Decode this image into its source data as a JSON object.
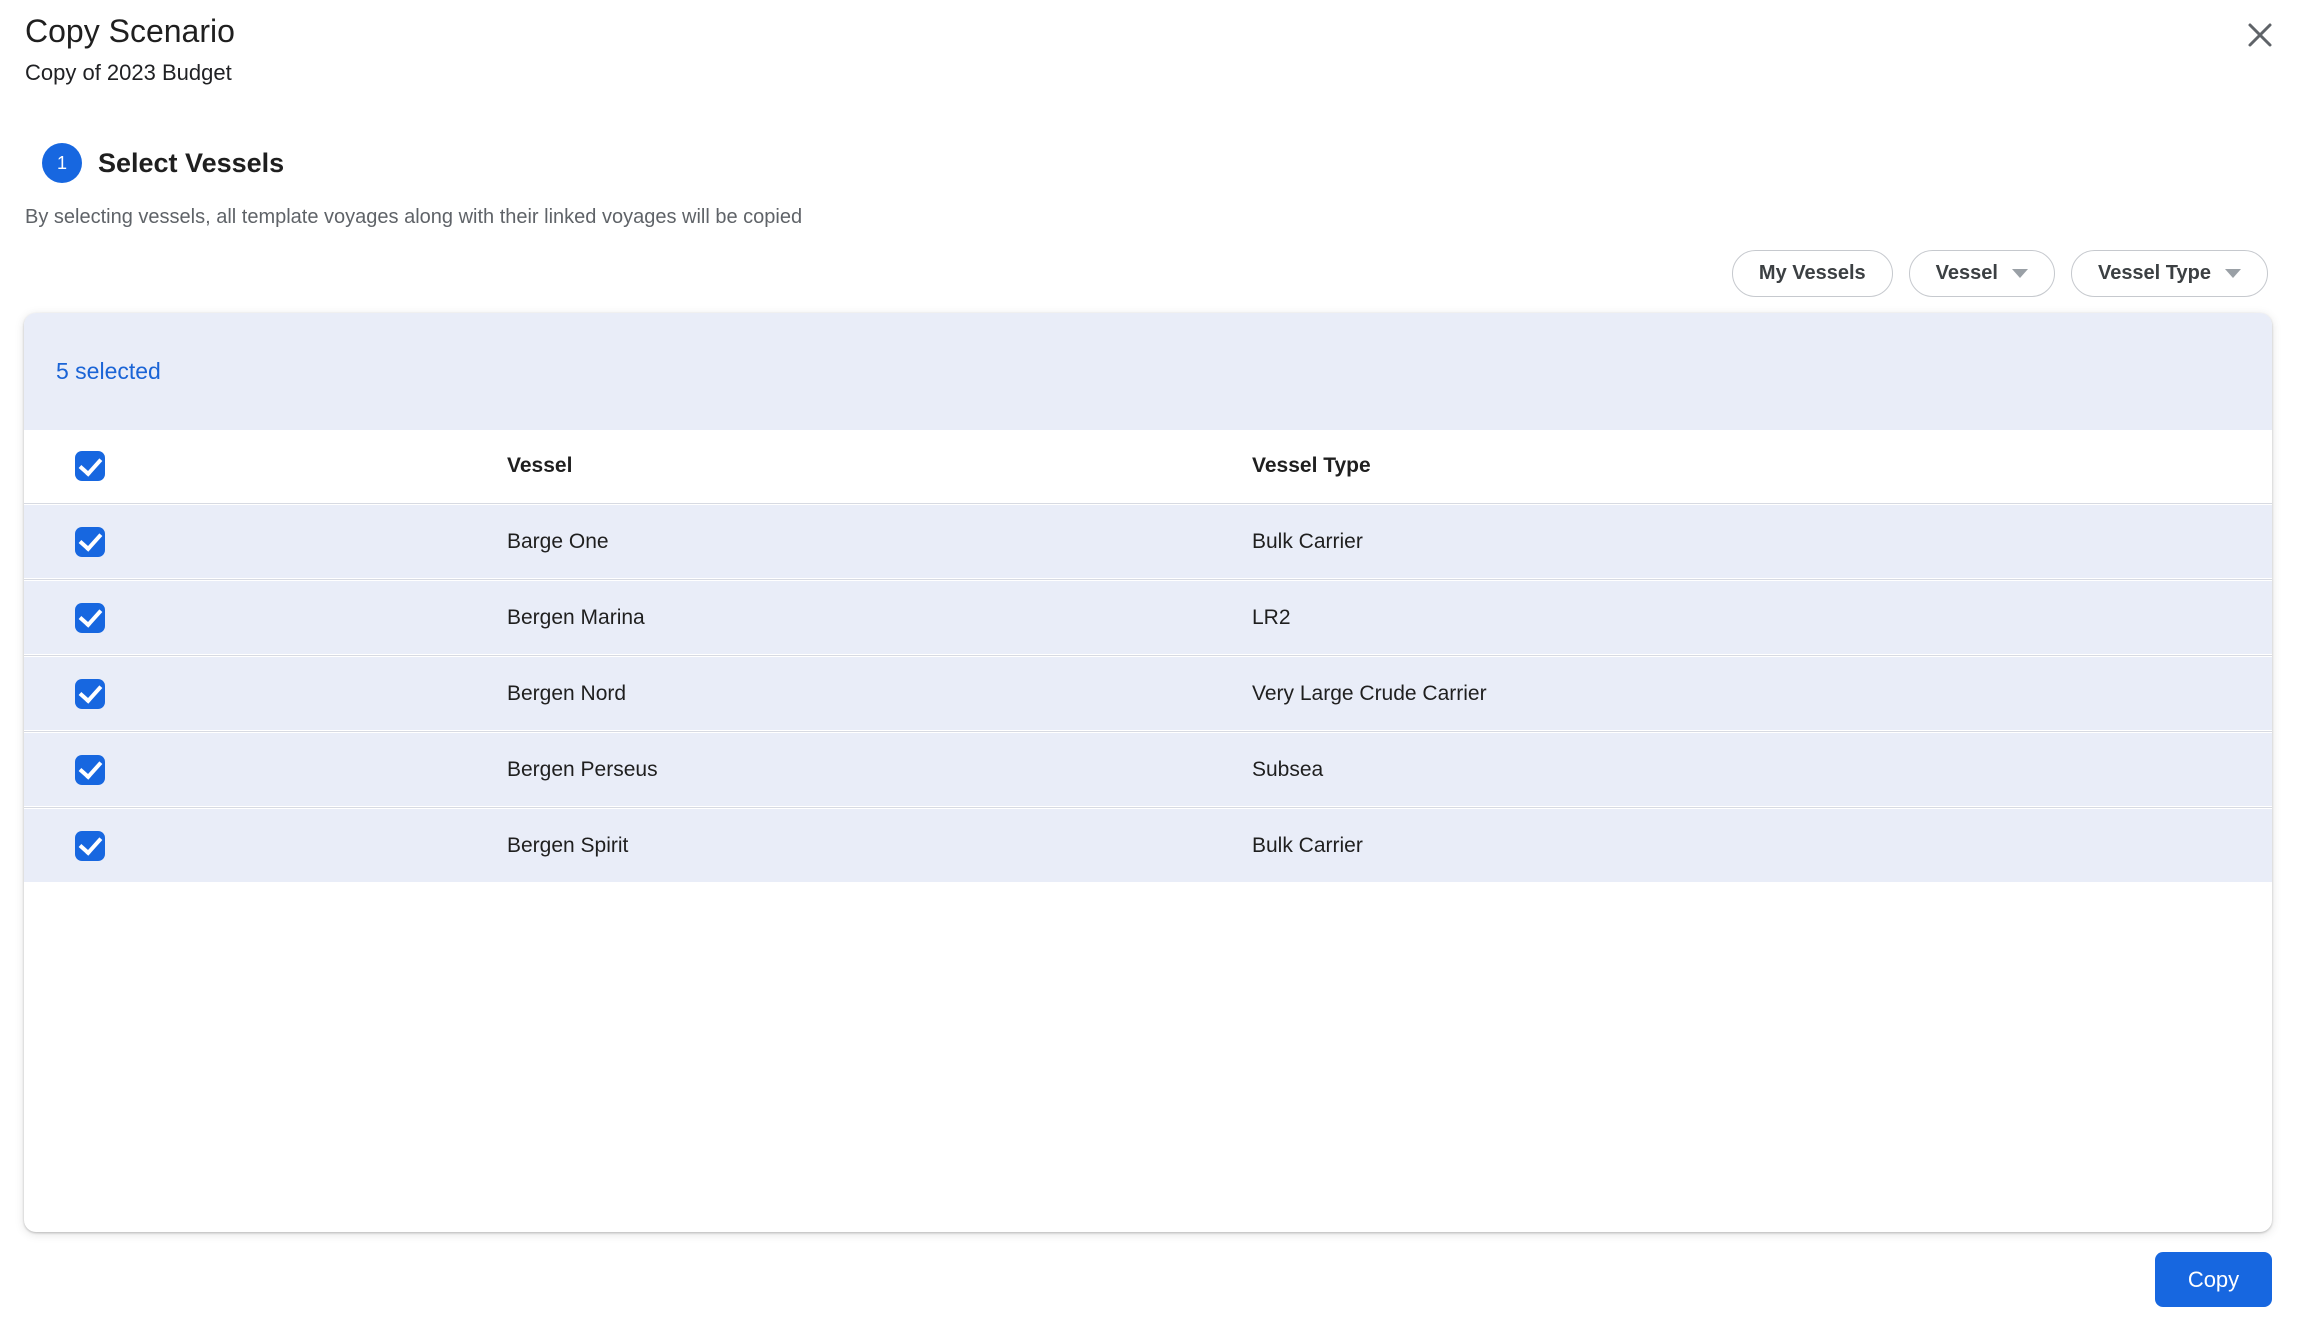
{
  "dialog": {
    "title": "Copy Scenario",
    "subtitle": "Copy of 2023 Budget"
  },
  "step": {
    "number": "1",
    "title": "Select Vessels",
    "description": "By selecting vessels, all template voyages along with their linked voyages will be copied"
  },
  "filters": {
    "buttons": [
      {
        "label": "My Vessels",
        "has_dropdown": false
      },
      {
        "label": "Vessel",
        "has_dropdown": true
      },
      {
        "label": "Vessel Type",
        "has_dropdown": true
      }
    ]
  },
  "table": {
    "selected_count_label": "5 selected",
    "select_all_checked": true,
    "columns": [
      "Vessel",
      "Vessel Type"
    ],
    "rows": [
      {
        "checked": true,
        "vessel": "Barge One",
        "vessel_type": "Bulk Carrier"
      },
      {
        "checked": true,
        "vessel": "Bergen Marina",
        "vessel_type": "LR2"
      },
      {
        "checked": true,
        "vessel": "Bergen Nord",
        "vessel_type": "Very Large Crude Carrier"
      },
      {
        "checked": true,
        "vessel": "Bergen Perseus",
        "vessel_type": "Subsea"
      },
      {
        "checked": true,
        "vessel": "Bergen Spirit",
        "vessel_type": "Bulk Carrier"
      }
    ]
  },
  "footer": {
    "copy_label": "Copy"
  },
  "icons": {
    "close": "close-icon",
    "dropdown": "chevron-down-icon",
    "check": "checkmark-icon"
  },
  "colors": {
    "accent": "#1767e0",
    "selected_text": "#1a64d6",
    "row_background": "#e9edf8",
    "muted_text": "#5f6368"
  }
}
